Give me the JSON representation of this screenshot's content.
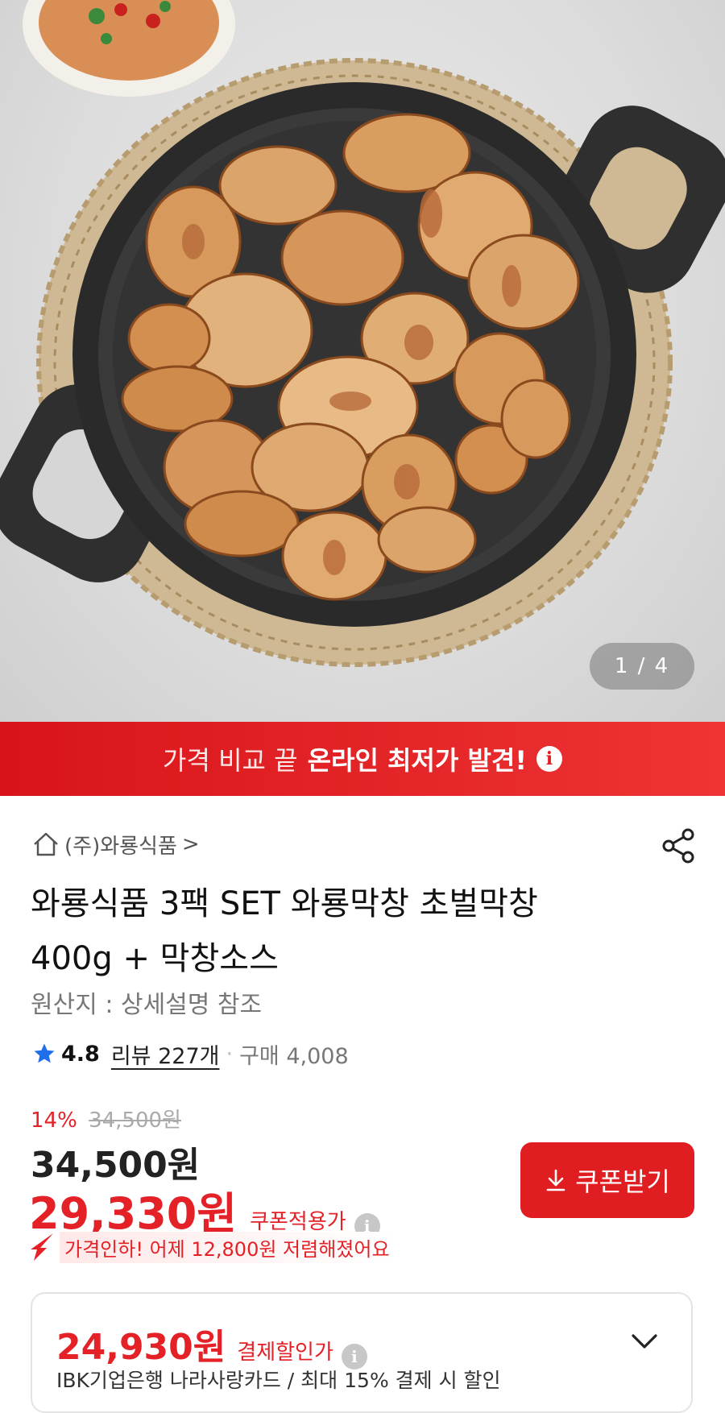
{
  "gallery": {
    "counter": "1 / 4",
    "current_index": 1,
    "total": 4
  },
  "banner": {
    "normal_text": "가격 비교 끝",
    "bold_text": "온라인 최저가 발견!",
    "info_glyph": "i"
  },
  "seller": {
    "name": "(주)와룡식품",
    "arrow": ">"
  },
  "product": {
    "title": "와룡식품 3팩 SET 와룡막창 초벌막창 400g + 막창소스",
    "origin": "원산지 : 상세설명 참조"
  },
  "rating": {
    "score": "4.8",
    "review_label": "리뷰 227개",
    "separator": "·",
    "purchase_label": "구매 4,008"
  },
  "pricing": {
    "discount_percent": "14%",
    "original_price": "34,500원",
    "sale_price": "34,500원",
    "coupon_price": "29,330원",
    "coupon_label": "쿠폰적용가",
    "coupon_button": "쿠폰받기",
    "price_drop": "가격인하! 어제 12,800원 저렴해졌어요"
  },
  "payment": {
    "price": "24,930원",
    "label": "결제할인가",
    "detail": "IBK기업은행 나라사랑카드 / 최대 15% 결제 시 할인"
  },
  "icons": {
    "home": "home-icon",
    "share": "share-icon",
    "star": "star-icon",
    "info": "info-icon",
    "download": "download-icon",
    "chevron": "chevron-down-icon",
    "drop": "price-drop-arrow-icon"
  },
  "colors": {
    "accent_red": "#e32127",
    "banner_red": "#e01e22",
    "star_blue": "#1f6feb",
    "text_gray": "#777777"
  }
}
